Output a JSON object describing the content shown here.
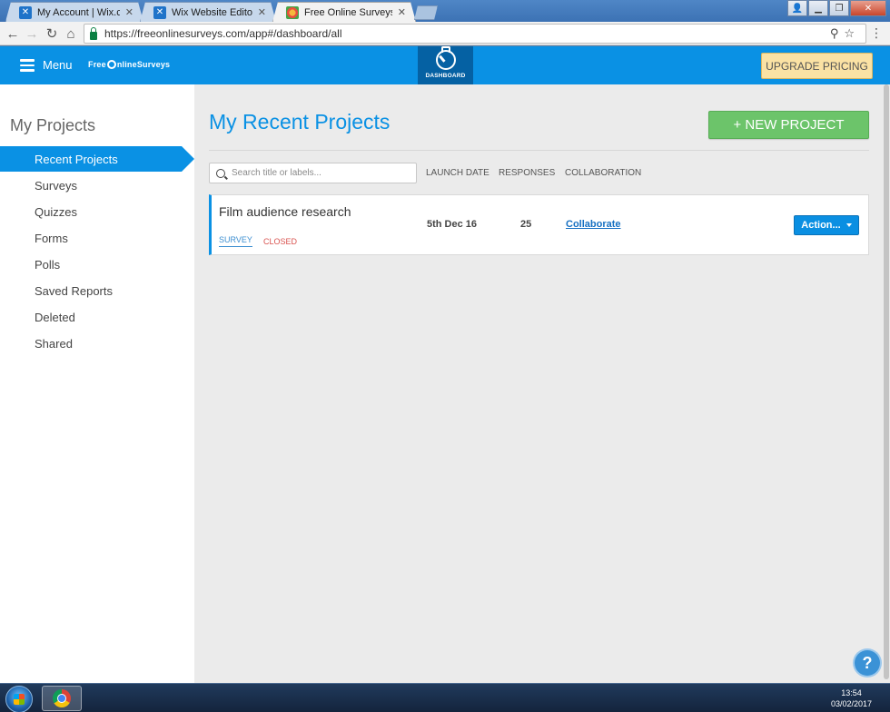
{
  "browser": {
    "tabs": [
      {
        "label": "My Account | Wix.com",
        "active": false
      },
      {
        "label": "Wix Website Editor",
        "active": false
      },
      {
        "label": "Free Online Surveys",
        "active": true
      }
    ],
    "url": "https://freeonlinesurveys.com/app#/dashboard/all"
  },
  "header": {
    "menu_label": "Menu",
    "brand_prefix": "Free",
    "brand_suffix": "nlineSurveys",
    "dashboard_label": "DASHBOARD",
    "upgrade_label": "UPGRADE PRICING"
  },
  "sidebar": {
    "title": "My Projects",
    "items": [
      {
        "label": "Recent Projects",
        "active": true
      },
      {
        "label": "Surveys"
      },
      {
        "label": "Quizzes"
      },
      {
        "label": "Forms"
      },
      {
        "label": "Polls"
      },
      {
        "label": "Saved Reports"
      },
      {
        "label": "Deleted"
      },
      {
        "label": "Shared"
      }
    ]
  },
  "main": {
    "title": "My Recent Projects",
    "new_project_label": "+ NEW PROJECT",
    "search_placeholder": "Search title or labels...",
    "columns": [
      "LAUNCH DATE",
      "RESPONSES",
      "COLLABORATION"
    ],
    "projects": [
      {
        "name": "Film audience research",
        "type": "SURVEY",
        "status": "CLOSED",
        "launch_date": "5th Dec 16",
        "responses": "25",
        "collaboration": "Collaborate",
        "action_label": "Action..."
      }
    ]
  },
  "help": {
    "label": "?"
  },
  "taskbar": {
    "time": "13:54",
    "date": "03/02/2017"
  },
  "colors": {
    "primary": "#0a91e4",
    "success": "#6cc46a",
    "upgrade": "#fbe2a4",
    "closed": "#d9534f"
  }
}
